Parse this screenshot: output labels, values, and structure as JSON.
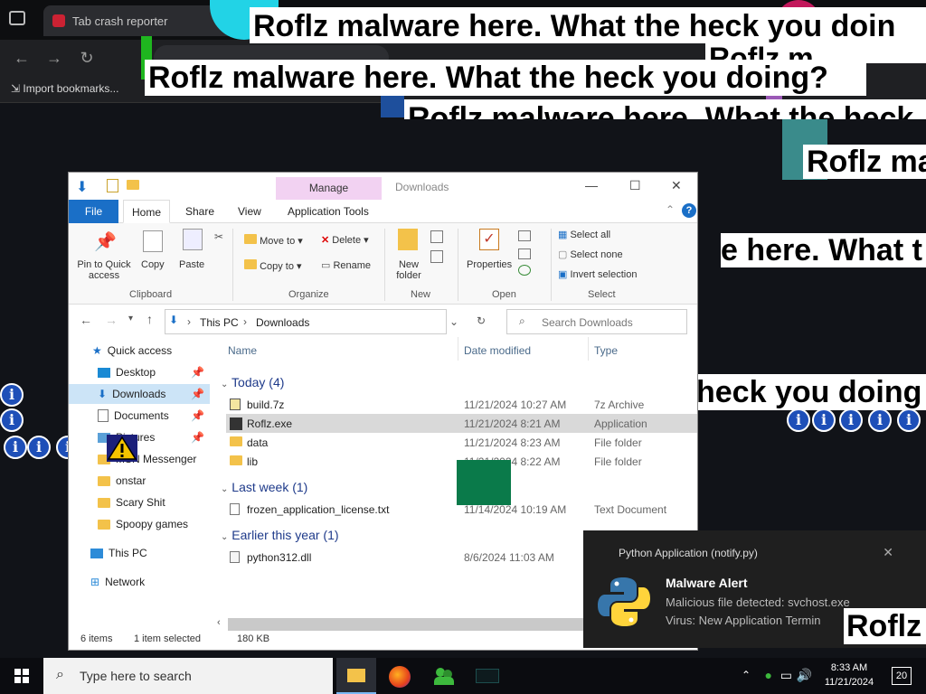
{
  "browser": {
    "tab_title": "Tab crash reporter",
    "bookmark": "Import bookmarks..."
  },
  "banners": {
    "text": "Roflz malware here. What the heck you doing?",
    "fragments": {
      "f1": "Roflz malware here. What the heck you doin",
      "f2": "Roflz malware here. What the heck you doing?",
      "f3": "Roflz malware here. What the heck",
      "f4": "Roflz ma",
      "f5": "e here. What t",
      "f6": "heck you doing",
      "f7": "Roflz",
      "f8": "Roflz m"
    }
  },
  "explorer": {
    "title": "Downloads",
    "manage_tab": "Manage",
    "tabs": [
      "File",
      "Home",
      "Share",
      "View",
      "Application Tools"
    ],
    "ribbon": {
      "clipboard": {
        "label": "Clipboard",
        "pin": "Pin to Quick access",
        "copy": "Copy",
        "paste": "Paste"
      },
      "organize": {
        "label": "Organize",
        "move_to": "Move to",
        "copy_to": "Copy to",
        "delete": "Delete",
        "rename": "Rename"
      },
      "new": {
        "label": "New",
        "new_folder": "New folder"
      },
      "open": {
        "label": "Open",
        "properties": "Properties"
      },
      "select": {
        "label": "Select",
        "select_all": "Select all",
        "select_none": "Select none",
        "invert": "Invert selection"
      }
    },
    "breadcrumb": [
      "This PC",
      "Downloads"
    ],
    "search_placeholder": "Search Downloads",
    "nav": [
      {
        "label": "Quick access"
      },
      {
        "label": "Desktop"
      },
      {
        "label": "Downloads"
      },
      {
        "label": "Documents"
      },
      {
        "label": "Pictures"
      },
      {
        "label": "MSN Messenger"
      },
      {
        "label": "onstar"
      },
      {
        "label": "Scary Shit"
      },
      {
        "label": "Spoopy games"
      },
      {
        "label": "This PC"
      },
      {
        "label": "Network"
      }
    ],
    "columns": {
      "name": "Name",
      "date": "Date modified",
      "type": "Type"
    },
    "groups": {
      "today": "Today (4)",
      "last_week": "Last week (1)",
      "earlier": "Earlier this year (1)"
    },
    "files": [
      {
        "name": "build.7z",
        "date": "11/21/2024 10:27 AM",
        "type": "7z Archive"
      },
      {
        "name": "Roflz.exe",
        "date": "11/21/2024 8:21 AM",
        "type": "Application"
      },
      {
        "name": "data",
        "date": "11/21/2024 8:23 AM",
        "type": "File folder"
      },
      {
        "name": "lib",
        "date": "11/21/2024 8:22 AM",
        "type": "File folder"
      },
      {
        "name": "frozen_application_license.txt",
        "date": "11/14/2024 10:19 AM",
        "type": "Text Document"
      },
      {
        "name": "python312.dll",
        "date": "8/6/2024 11:03 AM",
        "type": ""
      }
    ],
    "status": {
      "items": "6 items",
      "selected": "1 item selected",
      "size": "180 KB"
    }
  },
  "toast": {
    "app": "Python Application (notify.py)",
    "title": "Malware Alert",
    "line1": "Malicious file detected: svchost.exe",
    "line2": "Virus: New Application Termin"
  },
  "taskbar": {
    "search": "Type here to search",
    "time": "8:33 AM",
    "date": "11/21/2024",
    "notif_count": "20"
  }
}
